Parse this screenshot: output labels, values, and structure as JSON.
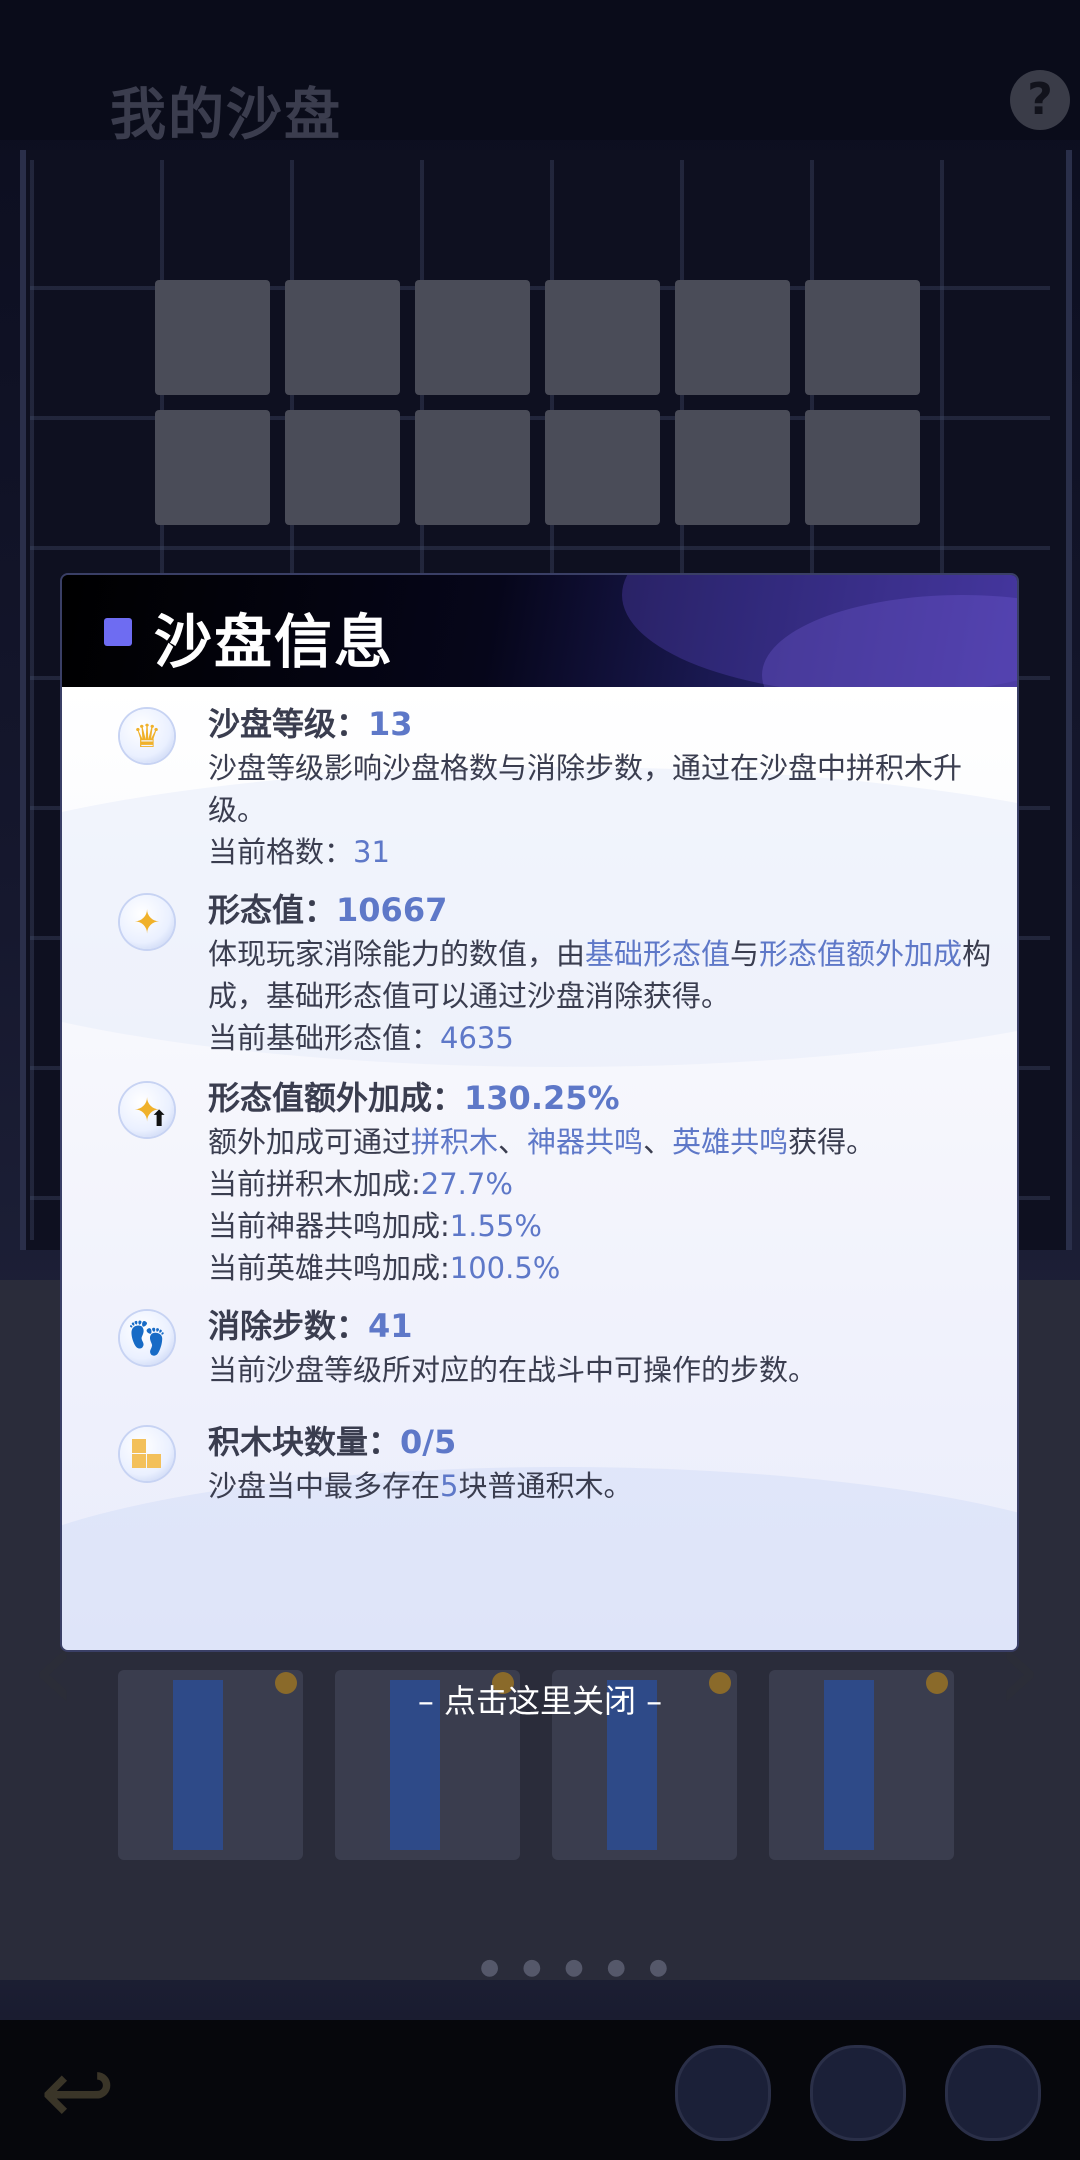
{
  "background": {
    "title": "我的沙盘",
    "help_icon": "?",
    "page_dots": "● ● ● ● ●"
  },
  "dialog": {
    "title": "沙盘信息",
    "sections": [
      {
        "icon": "crown-icon",
        "title": "沙盘等级：",
        "value": "13",
        "desc": "沙盘等级影响沙盘格数与消除步数，通过在沙盘中拼积木升级。",
        "current_label": "当前格数：",
        "current_value": "31"
      },
      {
        "icon": "sparkle-icon",
        "title": "形态值：",
        "value": "10667",
        "desc_part1": "体现玩家消除能力的数值，由",
        "link1": "基础形态值",
        "desc_part2": "与",
        "link2": "形态值额外加成",
        "desc_part3": "构成，基础形态值可以通过沙盘消除获得。",
        "current_label": "当前基础形态值：",
        "current_value": "4635"
      },
      {
        "icon": "sparkle-up-icon",
        "title": "形态值额外加成：",
        "value": "130.25%",
        "desc_part1": "额外加成可通过",
        "link1": "拼积木",
        "sep1": "、",
        "link2": "神器共鸣",
        "sep2": "、",
        "link3": "英雄共鸣",
        "desc_part2": "获得。",
        "line1_label": "当前拼积木加成:",
        "line1_value": "27.7%",
        "line2_label": "当前神器共鸣加成:",
        "line2_value": "1.55%",
        "line3_label": "当前英雄共鸣加成:",
        "line3_value": "100.5%"
      },
      {
        "icon": "footprint-icon",
        "title": "消除步数：",
        "value": "41",
        "desc": "当前沙盘等级所对应的在战斗中可操作的步数。"
      },
      {
        "icon": "blocks-icon",
        "title": "积木块数量：",
        "value": "0/5",
        "desc_part1": "沙盘当中最多存在",
        "desc_value": "5",
        "desc_part2": "块普通积木。"
      }
    ],
    "close_hint": "– 点击这里关闭 –"
  },
  "colors": {
    "accent_blue": "#5e78c8",
    "header_square": "#6e6cf2",
    "body_text": "#3a3d4f"
  }
}
